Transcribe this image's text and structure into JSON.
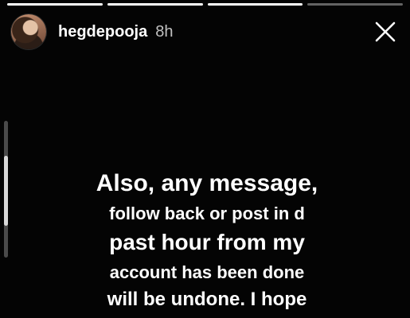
{
  "progress": [
    {
      "fill": 1.0
    },
    {
      "fill": 1.0
    },
    {
      "fill": 1.0
    },
    {
      "fill": 0.0
    }
  ],
  "header": {
    "username": "hegdepooja",
    "time": "8h"
  },
  "icons": {
    "avatar": "profile-photo",
    "close": "close-icon"
  },
  "colors": {
    "background": "#040404",
    "text": "#ffffff",
    "progress_track": "#5e5e5e",
    "scroll_thumb": "#d8d8d8"
  },
  "caption": {
    "lines": [
      "Also, any message,",
      "follow back or post in d",
      "past hour from my",
      "account has been done",
      "will be undone. I hope"
    ]
  }
}
